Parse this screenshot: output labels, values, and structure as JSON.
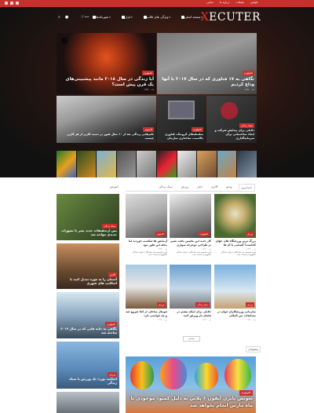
{
  "topbar": {
    "links": [
      "تماس",
      "درباره ما",
      "تبلیغات",
      "قوانین"
    ]
  },
  "header": {
    "logo_x": "X",
    "logo_rest": "ECUTER",
    "menu": [
      "صفحه اصلی",
      "ویژگی های قالب",
      "ابزار",
      "شورتکدها"
    ],
    "cart_label": "سبد",
    "search_icon": "search-icon"
  },
  "hero": {
    "cards": [
      {
        "tag": "تکنولوژی",
        "title": "نگاهی به ۱۷ فناوری که در سال ۲۰۱۷ با آنها وداع کردیم",
        "meta": "۱۳۹۶ ۰ دی"
      },
      {
        "tag": "تکنولوژی",
        "title": "آیا زندگی در سال ۲۰۱۸ مانند پیشبینی‌های یک قرن پیش است؟",
        "meta": "۱۳۹۶ ۰ دی"
      },
      {
        "tag": "سبک زندگی",
        "title": "دلایلی برای پیدایش شرکت و ایجاد ساختمانی برای سرمایه‌گذاری",
        "meta": ""
      },
      {
        "tag": "تکنولوژی",
        "title": "سلسله‌های کرونتک، فناوری بالاست، ساختاری سازمان",
        "meta": ""
      },
      {
        "tag": "کامپیوتر",
        "title": "علم‌هایی زندگی بعد از ۱۰ سال هنوز در دست کاربر از هر کاربر چیست",
        "meta": ""
      }
    ]
  },
  "tabs": {
    "items": [
      "جدیدترین",
      "ویدئو",
      "گالری",
      "اخبار",
      "ورزش",
      "سبک زندگی"
    ],
    "side_title": "آموزش"
  },
  "posts": [
    {
      "tag": "ورزش",
      "title": "بزرگ ترین ورزشگاه های جهان کجاست؟ آشنایی با آن ها",
      "meta": "۱۳۹۶ ۰ دی",
      "excerpt": "لورم ایپسوم متن ساختگی با تولید سادگی نامفهوم از صنعت چاپ"
    },
    {
      "tag": "تکنولوژی",
      "title": "کار جدید این ماشین باعث تغییر در طراحی دوچرخه سواری",
      "meta": "۱۳۹۶ ۰ دی",
      "excerpt": "لورم ایپسوم متن ساختگی با تولید سادگی نامفهوم از صنعت چاپ"
    },
    {
      "tag": "کامپیوتر",
      "title": "آزمایش ها شکست خوردند اما مجله این طور نبود",
      "meta": "۱۳۹۶ ۰ دی",
      "excerpt": "لورم ایپسوم متن ساختگی با تولید سادگی نامفهوم از صنعت چاپ"
    },
    {
      "tag": "ورزش",
      "title": "سازمانی ورزشکاران جوان در مسابقات بین المللی",
      "meta": "۱۳۹۶ ۰ دی",
      "excerpt": "لورم ایپسوم متن ساختگی با تولید سادگی نامفهوم از صنعت چاپ"
    },
    {
      "tag": "سبک زندگی",
      "title": "دلایلی برای اینکه بیشتر در فضای باز ورزش کنید",
      "meta": "۱۳۹۶ ۰ دی",
      "excerpt": "لورم ایپسوم متن ساختگی با تولید سادگی نامفهوم از صنعت چاپ"
    },
    {
      "tag": "ورزش",
      "title": "فوتبال ساحلی از کجا شروع شد و چه قوانینی دارد",
      "meta": "۱۳۹۶ ۰ دی",
      "excerpt": "لورم ایپسوم متن ساختگی با تولید سادگی نامفهوم از صنعت چاپ"
    }
  ],
  "pager_label": "بیشتر",
  "side": [
    {
      "tag": "سبک زندگی",
      "title": "پس ازتحقیقات جدید بشر با تصورات جدیدی مواجه شد"
    },
    {
      "tag": "گالری",
      "title": "آسمان را به موزه تبدیل کنید با اسکایپ های شهری"
    },
    {
      "tag": "تکنولوژی",
      "title": "نگاهی به خانه هایی که در سال ۲۰۱۷ ساخته شد"
    },
    {
      "tag": "ورزش",
      "title": "اسکیت بورد؛ یک ورزش یا سبک زندگی"
    }
  ],
  "section2_title": "پیشنهادی",
  "big": {
    "tag": "تکنولوژی",
    "title": "تعویض باتری آیفون ۶ پلاس به دلیل کمبود موجودی تا ماه مارس انجام نخواهد شد"
  }
}
